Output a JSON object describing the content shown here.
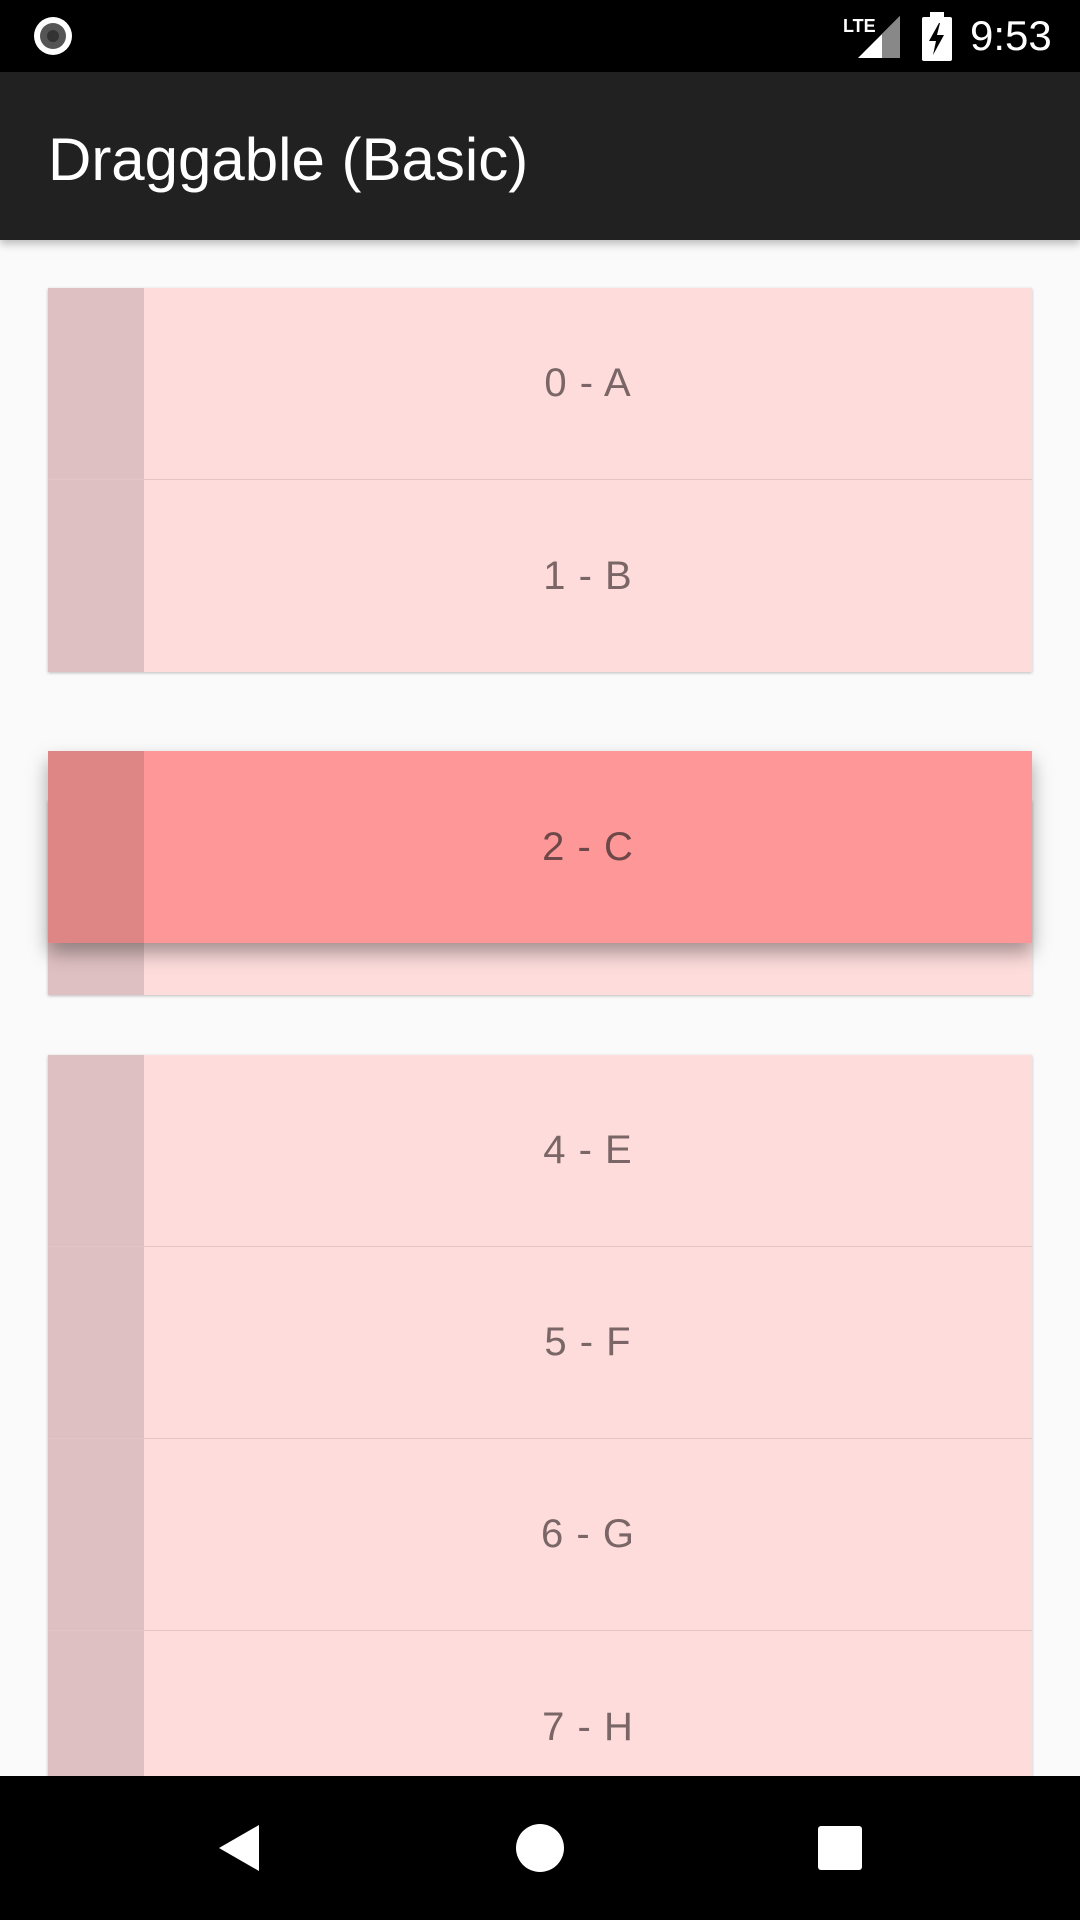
{
  "status_bar": {
    "network": "LTE",
    "time": "9:53"
  },
  "app_bar": {
    "title": "Draggable (Basic)"
  },
  "colors": {
    "item_background": "#fedcdc",
    "item_handle": "#dfc0c2",
    "dragging_background": "#fe9797",
    "dragging_handle": "#de8585",
    "app_bar": "#212121"
  },
  "list": {
    "group_1": [
      "0 - A",
      "1 - B"
    ],
    "dragging_item": "2 - C",
    "group_3": [
      "4 - E",
      "5 - F",
      "6 - G",
      "7 - H"
    ]
  },
  "nav_bar": {
    "back_icon": "back-triangle-icon",
    "home_icon": "home-circle-icon",
    "recents_icon": "recents-square-icon"
  }
}
